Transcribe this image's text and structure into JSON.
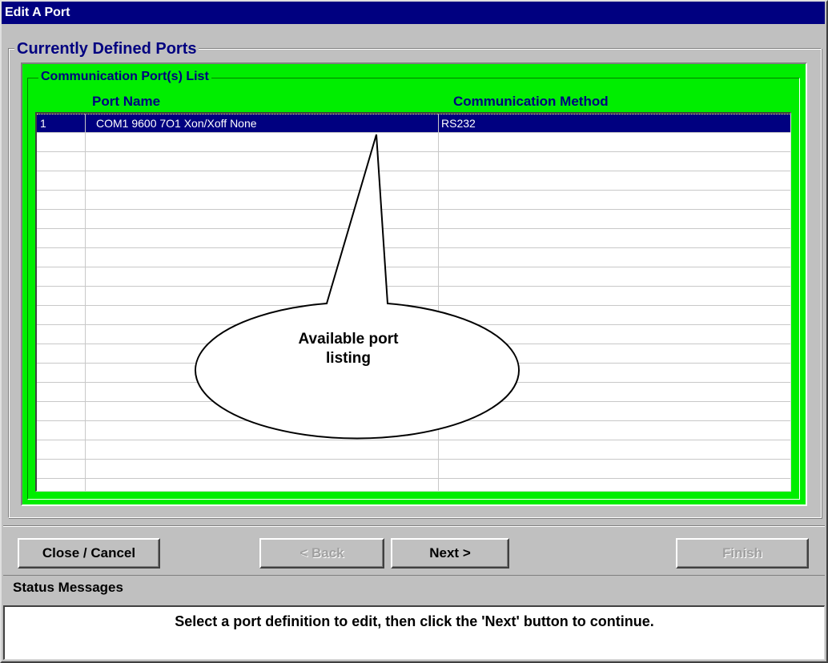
{
  "window": {
    "title": "Edit A Port"
  },
  "ports_group": {
    "label": "Currently Defined Ports"
  },
  "port_list": {
    "label": "Communication Port(s) List",
    "columns": [
      "Port Name",
      "Communication Method"
    ],
    "rows": [
      {
        "num": "1",
        "name": "COM1 9600 7O1 Xon/Xoff None",
        "method": "RS232",
        "selected": true
      }
    ]
  },
  "callout": {
    "line1": "Available port",
    "line2": "listing"
  },
  "buttons": {
    "close_cancel": "Close / Cancel",
    "back": "< Back",
    "next": "Next >",
    "finish": "Finish"
  },
  "status": {
    "title": "Status Messages",
    "message": "Select a port definition to edit, then click the 'Next' button to continue."
  },
  "colors": {
    "title_bar": "#000080",
    "list_panel": "#00ee00",
    "selection": "#000080"
  }
}
